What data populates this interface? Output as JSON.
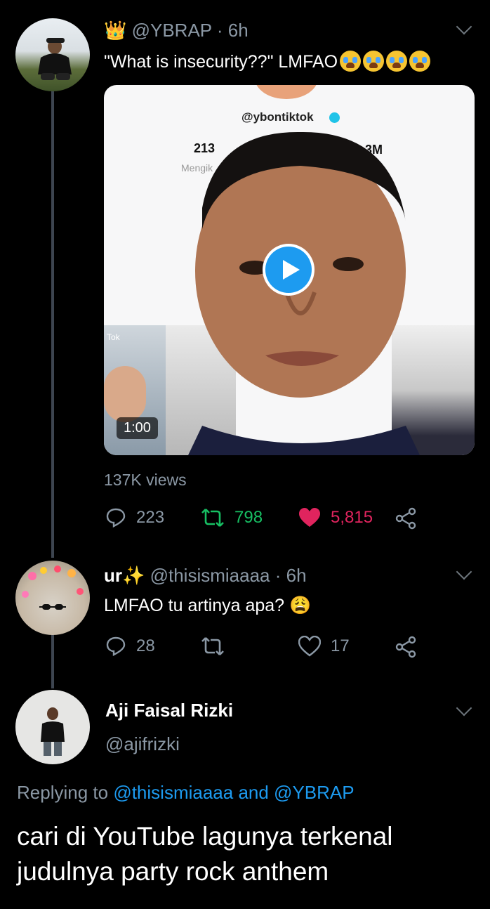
{
  "tweet1": {
    "display_name": "👑",
    "handle": "@YBRAP",
    "time": "· 6h",
    "text": "\"What is insecurity??\" LMFAO",
    "emoji": [
      "sob-emoji",
      "sob-emoji",
      "sob-emoji",
      "sob-emoji"
    ],
    "media": {
      "overlay_handle": "@ybontiktok",
      "stat_left": "213",
      "stat_left_label": "Mengik",
      "stat_right": "3M",
      "corner_label": "Tok",
      "duration": "1:00"
    },
    "views": "137K views",
    "replies": "223",
    "retweets": "798",
    "likes": "5,815"
  },
  "tweet2": {
    "display_name": "ur✨",
    "handle": "@thisismiaaaa",
    "time": "· 6h",
    "text": "LMFAO tu artinya apa? 😩",
    "replies": "28",
    "retweets": "",
    "likes": "17"
  },
  "tweet3": {
    "display_name": "Aji Faisal Rizki",
    "handle": "@ajifrizki",
    "replying_prefix": "Replying to",
    "replying_to": "@thisismiaaaa and @YBRAP",
    "text_line1": "cari di YouTube lagunya terkenal",
    "text_line2": "judulnya party rock anthem"
  },
  "colors": {
    "background": "#000000",
    "secondary_text": "#8b98a5",
    "link": "#1d9bf0",
    "retweet_active": "#17bf63",
    "like_active": "#e0245e",
    "thread_line": "#3d4550"
  }
}
